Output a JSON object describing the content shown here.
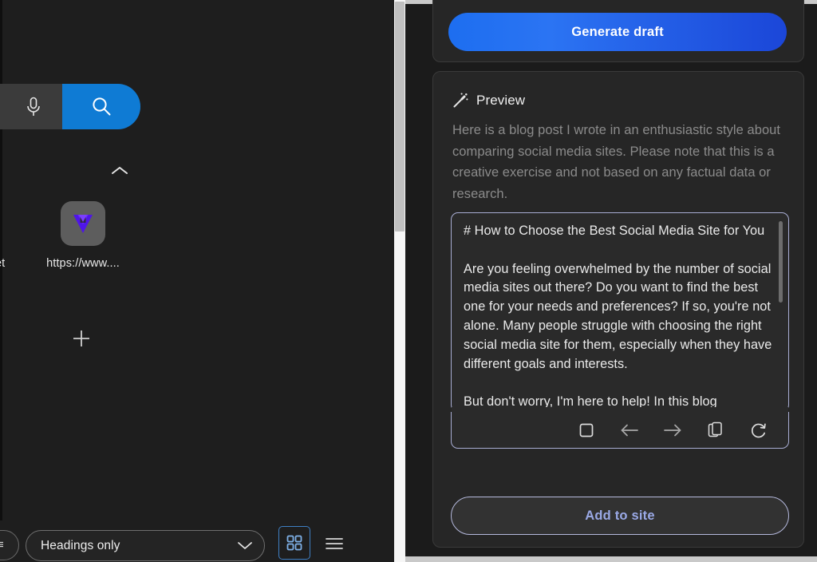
{
  "left_panel": {
    "search": {
      "mic_icon": "microphone-icon",
      "search_icon": "search-icon",
      "search_button_color": "#0f7bd4"
    },
    "collapse_icon": "chevron-up-icon",
    "shortcut_tile": {
      "logo_icon": "v-logo-icon",
      "label": "https://www....",
      "partial_label_left": "et"
    },
    "add_tile": {
      "icon": "plus-icon"
    },
    "bottom_bar": {
      "stub_glyph": "≡",
      "filter_select": {
        "value": "Headings only",
        "chevron_icon": "chevron-down-icon"
      },
      "grid_view": {
        "icon": "grid-view-icon",
        "selected": true,
        "accent": "#3f7fc4"
      },
      "list_view": {
        "icon": "list-view-icon",
        "selected": false
      }
    }
  },
  "scrollbar": {
    "track_color": "#f6f6f6",
    "thumb_color": "#c0c0c0"
  },
  "right_panel": {
    "generate": {
      "button_label": "Generate draft",
      "button_color": "#1d6ef0"
    },
    "preview": {
      "icon": "magic-wand-icon",
      "title": "Preview",
      "intro": "Here is a blog post I wrote in an enthusiastic style about comparing social media sites. Please note that this is a creative exercise and not based on any factual data or research.",
      "draft_text": "# How to Choose the Best Social Media Site for You\n\nAre you feeling overwhelmed by the number of social media sites out there? Do you want to find the best one for your needs and preferences? If so, you're not alone. Many people struggle with choosing the right social media site for them, especially when they have different goals and interests.\n\nBut don't worry, I'm here to help! In this blog",
      "border_color": "#a9aed4",
      "toolbar": [
        {
          "icon": "stop-square-icon",
          "name": "stop-button"
        },
        {
          "icon": "arrow-left-icon",
          "name": "previous-button"
        },
        {
          "icon": "arrow-right-icon",
          "name": "next-button"
        },
        {
          "icon": "copy-icon",
          "name": "copy-button"
        },
        {
          "icon": "refresh-icon",
          "name": "regenerate-button"
        }
      ],
      "add_to_site_label": "Add to site",
      "add_to_site_text_color": "#9aa9e6"
    }
  }
}
